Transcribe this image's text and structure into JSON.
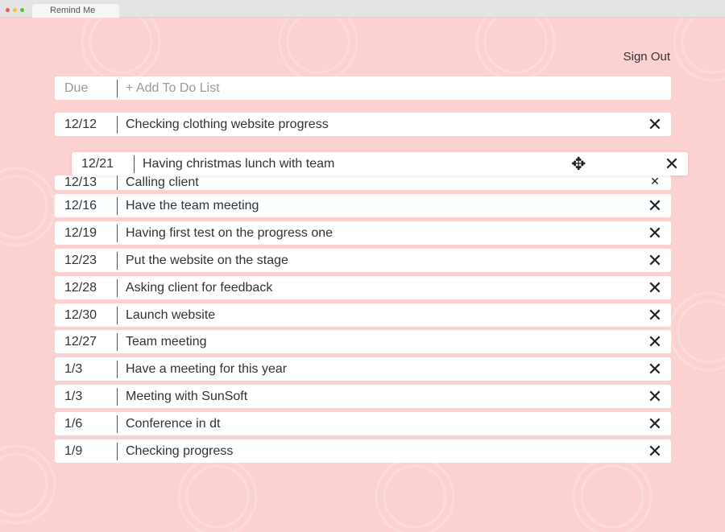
{
  "window": {
    "tab_title": "Remind Me"
  },
  "colors": {
    "background": "#fcd1d1",
    "row": "#ffffff",
    "dot_red": "#f0594f",
    "dot_yellow": "#f5be3c",
    "dot_green": "#56c241"
  },
  "header": {
    "sign_out": "Sign Out"
  },
  "add_row": {
    "due_placeholder": "Due",
    "text_placeholder": "+ Add To Do List"
  },
  "dragged": {
    "due": "12/21",
    "text": "Having christmas lunch with team",
    "close": "✕",
    "move_icon": "✥"
  },
  "todos": [
    {
      "due": "12/12",
      "text": "Checking clothing website progress",
      "close": "✕"
    },
    {
      "due": "12/13",
      "text": "Calling client",
      "close": "✕"
    },
    {
      "due": "12/16",
      "text": "Have the team meeting",
      "close": "✕"
    },
    {
      "due": "12/19",
      "text": "Having first test on the progress one",
      "close": "✕"
    },
    {
      "due": "12/23",
      "text": "Put the website on the stage",
      "close": "✕"
    },
    {
      "due": "12/28",
      "text": "Asking client for feedback",
      "close": "✕"
    },
    {
      "due": "12/30",
      "text": "Launch website",
      "close": "✕"
    },
    {
      "due": "12/27",
      "text": "Team meeting",
      "close": "✕"
    },
    {
      "due": "1/3",
      "text": "Have a meeting for this year",
      "close": "✕"
    },
    {
      "due": "1/3",
      "text": "Meeting with SunSoft",
      "close": "✕"
    },
    {
      "due": "1/6",
      "text": "Conference in dt",
      "close": "✕"
    },
    {
      "due": "1/9",
      "text": "Checking progress",
      "close": "✕"
    }
  ]
}
